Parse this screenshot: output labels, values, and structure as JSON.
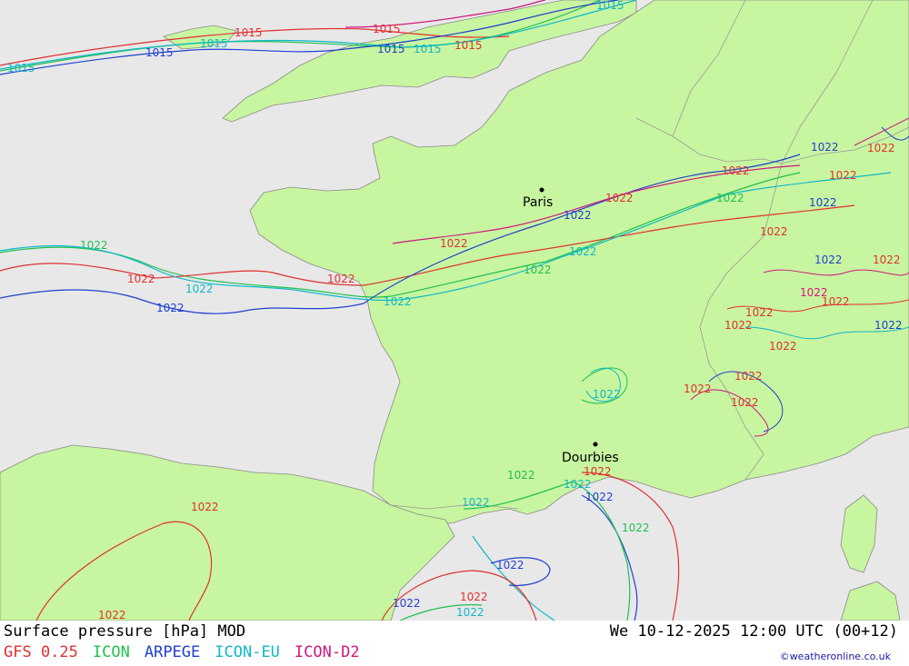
{
  "colors": {
    "sea": "#e8e8e8",
    "land": "#c8f5a0",
    "border": "#9a9a9a",
    "gfs": "#e03030",
    "icon": "#20c050",
    "arpege": "#2040d0",
    "icon_eu": "#10b8c8",
    "icon_d2": "#d01880"
  },
  "cities": [
    {
      "name": "Paris"
    },
    {
      "name": "Dourbies"
    }
  ],
  "isobar_labels": {
    "north": "1015",
    "main": "1022"
  },
  "footer": {
    "title": "Surface pressure [hPa] MOD",
    "datetime": "We 10-12-2025 12:00 UTC (00+12)",
    "models": [
      {
        "label": "GFS 0.25",
        "color": "#e03030"
      },
      {
        "label": "ICON",
        "color": "#20c050"
      },
      {
        "label": "ARPEGE",
        "color": "#2040d0"
      },
      {
        "label": "ICON-EU",
        "color": "#10b8c8"
      },
      {
        "label": "ICON-D2",
        "color": "#d01880"
      }
    ],
    "credit": "©weatheronline.co.uk"
  }
}
